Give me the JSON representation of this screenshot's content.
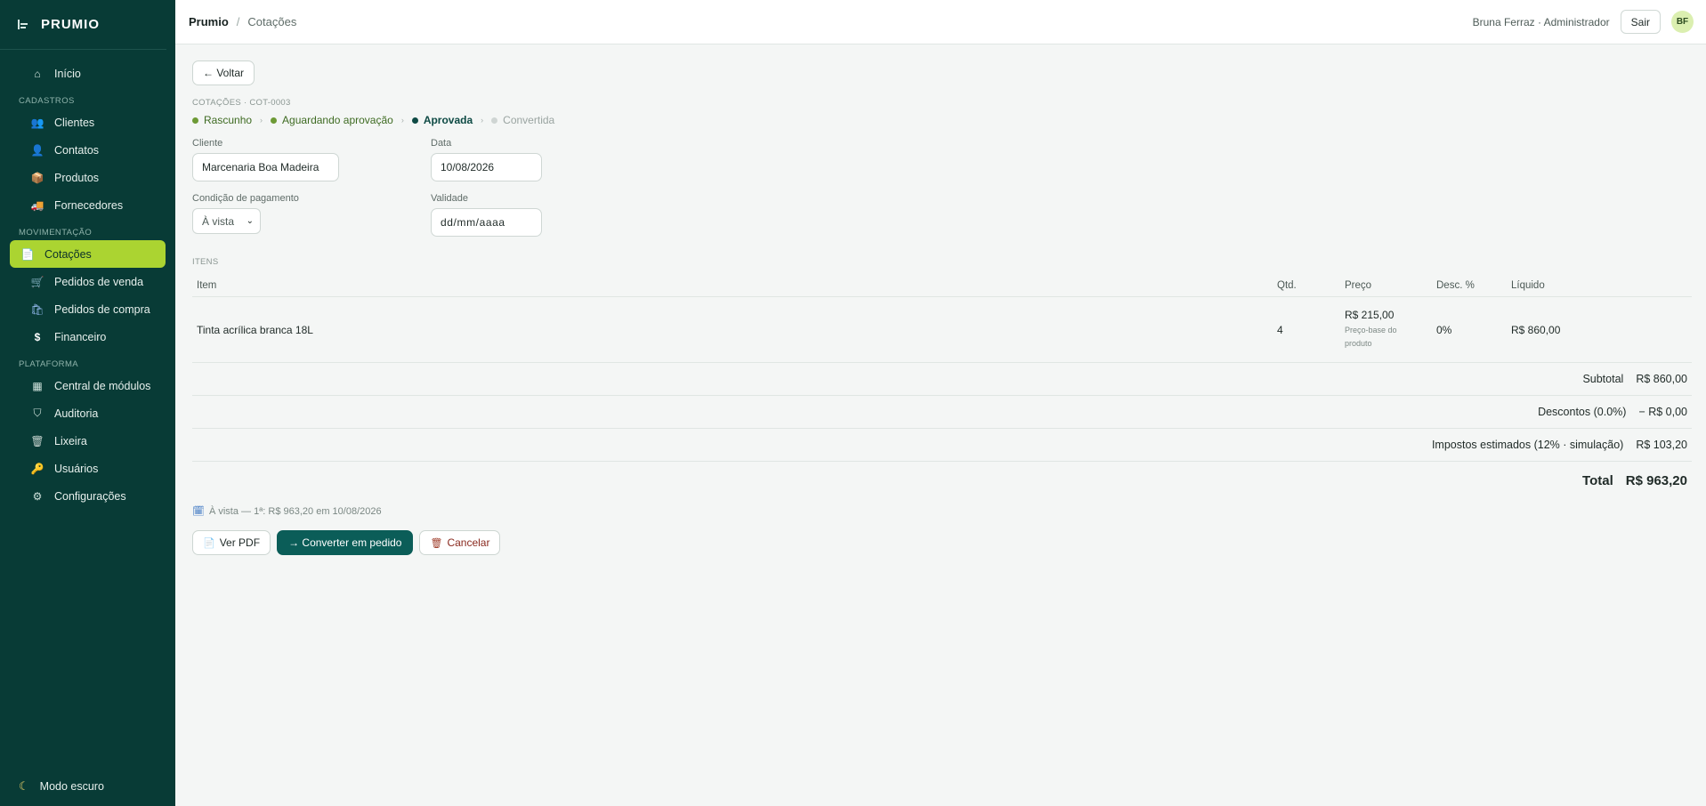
{
  "app": {
    "brand": "PRUMIO"
  },
  "sidebar": {
    "home": {
      "label": "Início",
      "icon": "home-icon"
    },
    "sections": [
      {
        "title": "CADASTROS",
        "items": [
          {
            "label": "Clientes",
            "icon": "clients-icon"
          },
          {
            "label": "Contatos",
            "icon": "contacts-icon"
          },
          {
            "label": "Produtos",
            "icon": "package-icon"
          },
          {
            "label": "Fornecedores",
            "icon": "truck-icon"
          }
        ]
      },
      {
        "title": "MOVIMENTAÇÃO",
        "items": [
          {
            "label": "Cotações",
            "icon": "document-icon",
            "active": true
          },
          {
            "label": "Pedidos de venda",
            "icon": "cart-icon"
          },
          {
            "label": "Pedidos de compra",
            "icon": "shopping-bag-icon"
          },
          {
            "label": "Financeiro",
            "icon": "dollar-icon"
          }
        ]
      },
      {
        "title": "PLATAFORMA",
        "items": [
          {
            "label": "Central de módulos",
            "icon": "grid-icon"
          },
          {
            "label": "Auditoria",
            "icon": "shield-icon"
          },
          {
            "label": "Lixeira",
            "icon": "trash-icon"
          },
          {
            "label": "Usuários",
            "icon": "key-icon"
          },
          {
            "label": "Configurações",
            "icon": "gear-icon"
          }
        ]
      }
    ],
    "footer": {
      "label": "Modo escuro",
      "icon": "moon-icon"
    }
  },
  "topbar": {
    "breadcrumb_root": "Prumio",
    "breadcrumb_sep": "/",
    "breadcrumb_page": "Cotações",
    "user": "Bruna Ferraz · Administrador",
    "logout_label": "Sair",
    "avatar_initials": "BF"
  },
  "quote": {
    "back_label": "← Voltar",
    "code": "COTAÇÕES · COT-0003",
    "steps": [
      {
        "label": "Rascunho",
        "state": "done"
      },
      {
        "label": "Aguardando aprovação",
        "state": "done"
      },
      {
        "label": "Aprovada",
        "state": "current"
      },
      {
        "label": "Convertida",
        "state": "pending"
      }
    ],
    "fields": {
      "cliente_label": "Cliente",
      "cliente_value": "Marcenaria Boa Madeira",
      "data_label": "Data",
      "data_value": "10/08/2026",
      "condicao_label": "Condição de pagamento",
      "condicao_value": "À vista",
      "validade_label": "Validade",
      "validade_placeholder": "dd/mm/aaaa"
    },
    "items_title": "ITENS",
    "table": {
      "headers": {
        "item": "Item",
        "qtd": "Qtd.",
        "preco": "Preço",
        "desc": "Desc. %",
        "liquido": "Líquido"
      },
      "rows": [
        {
          "item": "Tinta acrílica branca 18L",
          "qtd": "4",
          "preco": "R$ 215,00",
          "preco_note": "Preço-base do produto",
          "desc": "0%",
          "liquido": "R$ 860,00"
        }
      ]
    },
    "totals": {
      "subtotal_label": "Subtotal",
      "subtotal_value": "R$ 860,00",
      "descontos_label": "Descontos (0.0%)",
      "descontos_value": "− R$ 0,00",
      "impostos_label": "Impostos estimados (12% · simulação)",
      "impostos_value": "R$ 103,20",
      "total_label": "Total",
      "total_value": "R$ 963,20"
    },
    "payment_note": "À vista — 1ª: R$ 963,20 em 10/08/2026",
    "actions": {
      "pdf_label": "Ver PDF",
      "convert_label": "→ Converter em pedido",
      "cancel_label": "Cancelar"
    }
  },
  "colors": {
    "sidebar_bg": "#083b36",
    "active_item": "#abd431",
    "primary_button": "#0b5d58",
    "step_done": "#6d9a35",
    "step_current": "#0e4a44"
  }
}
